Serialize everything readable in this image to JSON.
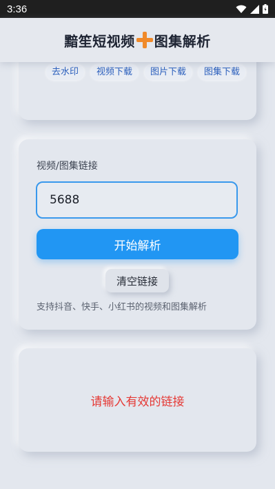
{
  "status_bar": {
    "time": "3:36"
  },
  "header": {
    "title_left": "黯笙短视频",
    "title_right": "图集解析"
  },
  "features": {
    "chips": [
      "去水印",
      "视频下载",
      "图片下载",
      "图集下载"
    ]
  },
  "input_card": {
    "label": "视频/图集链接",
    "input_value": "5688",
    "parse_label": "开始解析",
    "clear_label": "清空链接",
    "support_text": "支持抖音、快手、小红书的视频和图集解析"
  },
  "result": {
    "message": "请输入有效的链接"
  },
  "colors": {
    "accent": "#2196f3",
    "error": "#e53935",
    "plus": "#f08a2a"
  },
  "icons": [
    "wifi-icon",
    "signal-icon",
    "battery-icon",
    "plus-icon"
  ]
}
